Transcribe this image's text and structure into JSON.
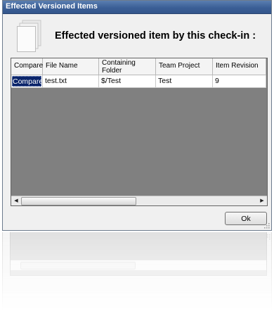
{
  "window": {
    "title": "Effected Versioned Items",
    "heading": "Effected versioned item by this check-in :"
  },
  "grid": {
    "columns": [
      "Compare",
      "File Name",
      "Containing Folder",
      "Team Project",
      "Item Revision"
    ],
    "rows": [
      {
        "compare": "Compare",
        "file_name": "test.txt",
        "containing_folder": "$/Test",
        "team_project": "Test",
        "item_revision": "9"
      }
    ]
  },
  "buttons": {
    "ok": "Ok"
  },
  "reflection": {
    "ok": "OK"
  },
  "colors": {
    "title_bar": "#3b5f96",
    "grid_background": "#808080",
    "selected_button": "#0a246a"
  },
  "icons": {
    "document": "document-stack-icon",
    "scroll_left": "scroll-left-arrow-icon",
    "scroll_right": "scroll-right-arrow-icon",
    "resize_grip": "resize-grip-icon"
  }
}
